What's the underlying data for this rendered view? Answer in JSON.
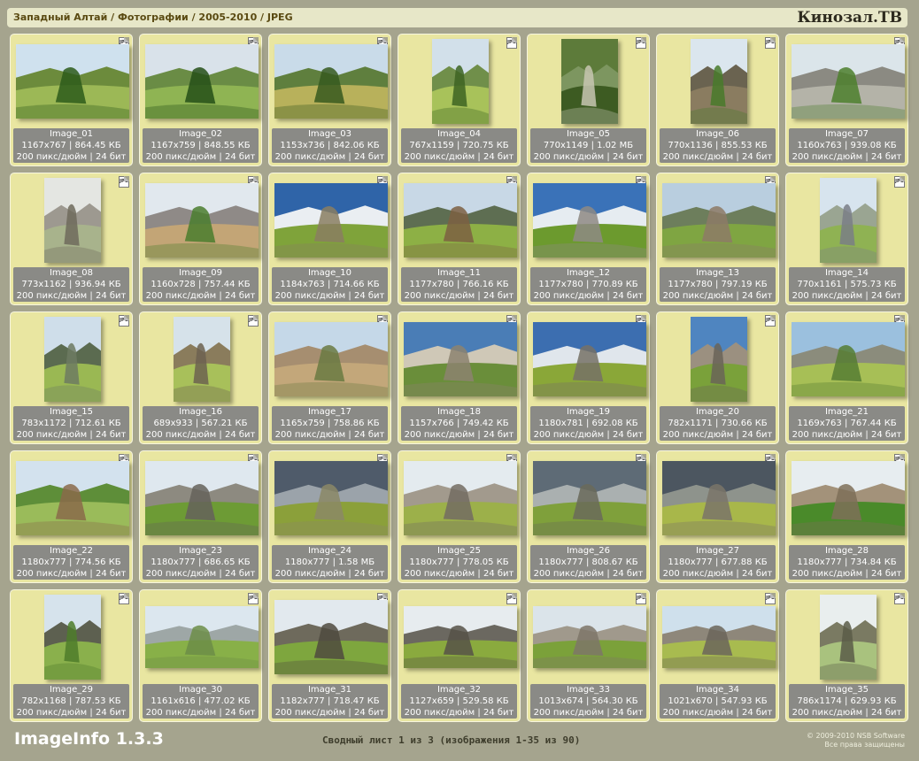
{
  "header": {
    "breadcrumb": "Западный Алтай / Фотографии / 2005-2010 / JPEG",
    "brand": "Кинозал.ТВ"
  },
  "file_badge": "JPG",
  "images": [
    {
      "name": "Image_01",
      "dims": "1167x767",
      "size": "864.45 КБ",
      "res": "200 пикс/дюйм | 24 бит",
      "orient": "land",
      "palette": [
        "#cfe1ee",
        "#6c8b3c",
        "#2d5a1a",
        "#9cb856"
      ]
    },
    {
      "name": "Image_02",
      "dims": "1167x759",
      "size": "848.55 КБ",
      "res": "200 пикс/дюйм | 24 бит",
      "orient": "land",
      "palette": [
        "#d9e2ea",
        "#6a8c45",
        "#254f17",
        "#8fb453"
      ]
    },
    {
      "name": "Image_03",
      "dims": "1153x736",
      "size": "842.06 КБ",
      "res": "200 пикс/дюйм | 24 бит",
      "orient": "land",
      "palette": [
        "#c9dbe9",
        "#5f7f3e",
        "#36591f",
        "#b8b15b"
      ]
    },
    {
      "name": "Image_04",
      "dims": "767x1159",
      "size": "720.75 КБ",
      "res": "200 пикс/дюйм | 24 бит",
      "orient": "port",
      "palette": [
        "#d2e0ea",
        "#708f4a",
        "#3d6422",
        "#a8c25a"
      ]
    },
    {
      "name": "Image_05",
      "dims": "770x1149",
      "size": "1.02 МБ",
      "res": "200 пикс/дюйм | 24 бит",
      "orient": "port",
      "palette": [
        "#5d7b3a",
        "#7d9660",
        "#c7c7b2",
        "#3d5b22"
      ]
    },
    {
      "name": "Image_06",
      "dims": "770x1136",
      "size": "855.53 КБ",
      "res": "200 пикс/дюйм | 24 бит",
      "orient": "port",
      "palette": [
        "#dbe6ee",
        "#6a6350",
        "#487a2a",
        "#8a7c60"
      ]
    },
    {
      "name": "Image_07",
      "dims": "1160x763",
      "size": "939.08 КБ",
      "res": "200 пикс/дюйм | 24 бит",
      "orient": "land",
      "palette": [
        "#dbe5ea",
        "#8b8a82",
        "#4c7f2d",
        "#b4b3a8"
      ]
    },
    {
      "name": "Image_08",
      "dims": "773x1162",
      "size": "936.94 КБ",
      "res": "200 пикс/дюйм | 24 бит",
      "orient": "port",
      "palette": [
        "#e4e6e2",
        "#9d9990",
        "#6f6a5c",
        "#a8b38c"
      ]
    },
    {
      "name": "Image_09",
      "dims": "1160x728",
      "size": "757.44 КБ",
      "res": "200 пикс/дюйм | 24 бит",
      "orient": "land",
      "palette": [
        "#e1e8ee",
        "#8f8a87",
        "#4a7d2e",
        "#c3a576"
      ]
    },
    {
      "name": "Image_10",
      "dims": "1184x763",
      "size": "714.66 КБ",
      "res": "200 пикс/дюйм | 24 бит",
      "orient": "land",
      "palette": [
        "#2f64a8",
        "#eaeef2",
        "#8a7e62",
        "#7fa33a"
      ]
    },
    {
      "name": "Image_11",
      "dims": "1177x780",
      "size": "766.16 КБ",
      "res": "200 пикс/дюйм | 24 бит",
      "orient": "land",
      "palette": [
        "#c8d8e6",
        "#5e6e52",
        "#7d6042",
        "#8db045"
      ]
    },
    {
      "name": "Image_12",
      "dims": "1177x780",
      "size": "770.89 КБ",
      "res": "200 пикс/дюйм | 24 бит",
      "orient": "land",
      "palette": [
        "#3a72b8",
        "#e6ecf1",
        "#8e8a84",
        "#6c9a2e"
      ]
    },
    {
      "name": "Image_13",
      "dims": "1177x780",
      "size": "797.19 КБ",
      "res": "200 пикс/дюйм | 24 бит",
      "orient": "land",
      "palette": [
        "#b9cedf",
        "#6d7e5c",
        "#8d7a66",
        "#7fa542"
      ]
    },
    {
      "name": "Image_14",
      "dims": "770x1161",
      "size": "575.73 КБ",
      "res": "200 пикс/дюйм | 24 бит",
      "orient": "port",
      "palette": [
        "#d7e4ee",
        "#9aa592",
        "#7a7e86",
        "#8fb253"
      ]
    },
    {
      "name": "Image_15",
      "dims": "783x1172",
      "size": "712.61 КБ",
      "res": "200 пикс/дюйм | 24 бит",
      "orient": "port",
      "palette": [
        "#cfdeea",
        "#5b6b50",
        "#6d7a62",
        "#9ab853"
      ]
    },
    {
      "name": "Image_16",
      "dims": "689x933",
      "size": "567.21 КБ",
      "res": "200 пикс/дюйм | 24 бит",
      "orient": "port",
      "palette": [
        "#d6e2ea",
        "#8a7c5c",
        "#6c6250",
        "#a8c05a"
      ]
    },
    {
      "name": "Image_17",
      "dims": "1165x759",
      "size": "758.86 КБ",
      "res": "200 пикс/дюйм | 24 бит",
      "orient": "land",
      "palette": [
        "#c5d8e8",
        "#a68e70",
        "#6a7a42",
        "#c3a77a"
      ]
    },
    {
      "name": "Image_18",
      "dims": "1157x766",
      "size": "749.42 КБ",
      "res": "200 пикс/дюйм | 24 бит",
      "orient": "land",
      "palette": [
        "#4a7db6",
        "#cfc8b7",
        "#8c8270",
        "#6a8e3a"
      ]
    },
    {
      "name": "Image_19",
      "dims": "1180x781",
      "size": "692.08 КБ",
      "res": "200 пикс/дюйм | 24 бит",
      "orient": "land",
      "palette": [
        "#3c6eb0",
        "#e0e6ec",
        "#757166",
        "#8aa738"
      ]
    },
    {
      "name": "Image_20",
      "dims": "782x1171",
      "size": "730.66 КБ",
      "res": "200 пикс/дюйм | 24 бит",
      "orient": "port",
      "palette": [
        "#4f85c0",
        "#9b9080",
        "#6a6458",
        "#7aa13a"
      ]
    },
    {
      "name": "Image_21",
      "dims": "1169x763",
      "size": "767.44 КБ",
      "res": "200 пикс/дюйм | 24 бит",
      "orient": "land",
      "palette": [
        "#9bc0de",
        "#8b8c7c",
        "#567c32",
        "#a7bf56"
      ]
    },
    {
      "name": "Image_22",
      "dims": "1180x777",
      "size": "774.56 КБ",
      "res": "200 пикс/дюйм | 24 бит",
      "orient": "land",
      "palette": [
        "#d3e2ee",
        "#5e8e39",
        "#8a6a4a",
        "#9abb5a"
      ]
    },
    {
      "name": "Image_23",
      "dims": "1180x777",
      "size": "686.65 КБ",
      "res": "200 пикс/дюйм | 24 бит",
      "orient": "land",
      "palette": [
        "#dfe8ef",
        "#8d8a80",
        "#65625a",
        "#6d9b35"
      ]
    },
    {
      "name": "Image_24",
      "dims": "1180x777",
      "size": "1.58 МБ",
      "res": "200 пикс/дюйм | 24 бит",
      "orient": "land",
      "palette": [
        "#4f5b6a",
        "#9ba3aa",
        "#8b8866",
        "#8ba03a"
      ]
    },
    {
      "name": "Image_25",
      "dims": "1180x777",
      "size": "778.05 КБ",
      "res": "200 пикс/дюйм | 24 бит",
      "orient": "land",
      "palette": [
        "#e4ebef",
        "#a29a8d",
        "#736c62",
        "#9cb04a"
      ]
    },
    {
      "name": "Image_26",
      "dims": "1180x777",
      "size": "808.67 КБ",
      "res": "200 пикс/дюйм | 24 бит",
      "orient": "land",
      "palette": [
        "#5e6b76",
        "#aab0b0",
        "#6a6a5a",
        "#7fa03b"
      ]
    },
    {
      "name": "Image_27",
      "dims": "1180x777",
      "size": "677.88 КБ",
      "res": "200 пикс/дюйм | 24 бит",
      "orient": "land",
      "palette": [
        "#4c5660",
        "#8e938c",
        "#7a7468",
        "#a8b74a"
      ]
    },
    {
      "name": "Image_28",
      "dims": "1180x777",
      "size": "734.84 КБ",
      "res": "200 пикс/дюйм | 24 бит",
      "orient": "land",
      "palette": [
        "#e7edf0",
        "#a3927a",
        "#7e6e58",
        "#4a8a2a"
      ]
    },
    {
      "name": "Image_29",
      "dims": "782x1168",
      "size": "787.53 КБ",
      "res": "200 пикс/дюйм | 24 бит",
      "orient": "port",
      "palette": [
        "#d6e3ec",
        "#5d6050",
        "#4e7c2a",
        "#8ab04c"
      ]
    },
    {
      "name": "Image_30",
      "dims": "1161x616",
      "size": "477.02 КБ",
      "res": "200 пикс/дюйм | 24 бит",
      "orient": "wide",
      "palette": [
        "#dce7ef",
        "#9ea7a6",
        "#6c8d48",
        "#88b048"
      ]
    },
    {
      "name": "Image_31",
      "dims": "1182x777",
      "size": "718.47 КБ",
      "res": "200 пикс/дюйм | 24 бит",
      "orient": "land",
      "palette": [
        "#e2e9ee",
        "#6e6a5c",
        "#4f4a3e",
        "#7ea63e"
      ]
    },
    {
      "name": "Image_32",
      "dims": "1127x659",
      "size": "529.58 КБ",
      "res": "200 пикс/дюйм | 24 бит",
      "orient": "wide",
      "palette": [
        "#e7ecef",
        "#6b6860",
        "#565248",
        "#8aaa3e"
      ]
    },
    {
      "name": "Image_33",
      "dims": "1013x674",
      "size": "564.30 КБ",
      "res": "200 пикс/дюйм | 24 бит",
      "orient": "wide",
      "palette": [
        "#dbe4ea",
        "#a0998c",
        "#7e7668",
        "#7ba13a"
      ]
    },
    {
      "name": "Image_34",
      "dims": "1021x670",
      "size": "547.93 КБ",
      "res": "200 пикс/дюйм | 24 бит",
      "orient": "wide",
      "palette": [
        "#cfe0ec",
        "#8e877a",
        "#6b655a",
        "#a8bb4f"
      ]
    },
    {
      "name": "Image_35",
      "dims": "786x1174",
      "size": "629.93 КБ",
      "res": "200 пикс/дюйм | 24 бит",
      "orient": "port",
      "palette": [
        "#e9eeee",
        "#7a7a62",
        "#5a5c48",
        "#a9c27e"
      ]
    }
  ],
  "footer": {
    "app_name": "ImageInfo 1.3.3",
    "summary": "Сводный лист 1 из 3 (изображения 1-35 из 90)",
    "copyright": "© 2009-2010 NSB Software",
    "rights": "Все права защищены"
  }
}
